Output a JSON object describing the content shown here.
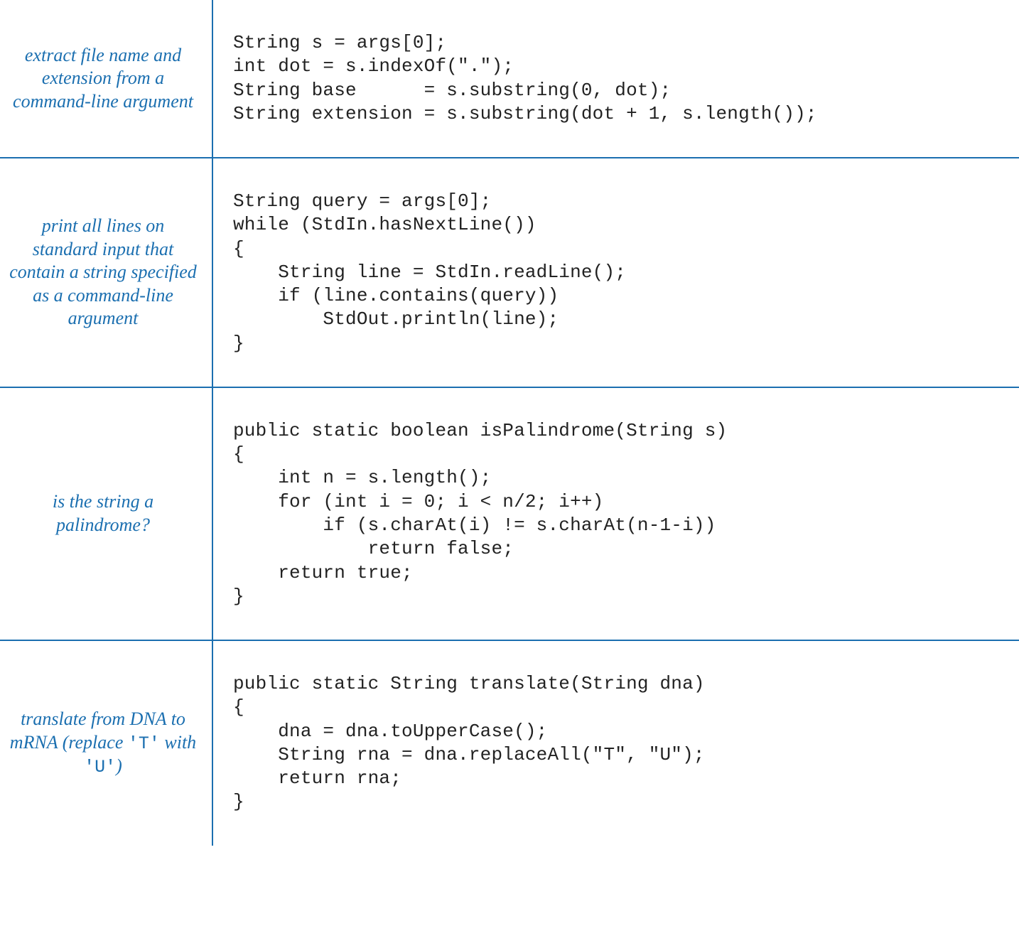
{
  "rows": [
    {
      "desc_html": "extract file name and extension from a command-line argument",
      "code": "String s = args[0];\nint dot = s.indexOf(\".\");\nString base      = s.substring(0, dot);\nString extension = s.substring(dot + 1, s.length());"
    },
    {
      "desc_html": "print all lines on standard input that contain a string specified as a command-line argument",
      "code": "String query = args[0];\nwhile (StdIn.hasNextLine())\n{\n    String line = StdIn.readLine();\n    if (line.contains(query))\n        StdOut.println(line);\n}"
    },
    {
      "desc_html": "is the string a palindrome?",
      "code": "public static boolean isPalindrome(String s)\n{\n    int n = s.length();\n    for (int i = 0; i < n/2; i++)\n        if (s.charAt(i) != s.charAt(n-1-i))\n            return false;\n    return true;\n}"
    },
    {
      "desc_html": "translate from DNA to mRNA (replace <span class=\"mono\">'T'</span> with <span class=\"mono\">'U'</span>)",
      "code": "public static String translate(String dna)\n{\n    dna = dna.toUpperCase();\n    String rna = dna.replaceAll(\"T\", \"U\");\n    return rna;\n}"
    }
  ]
}
